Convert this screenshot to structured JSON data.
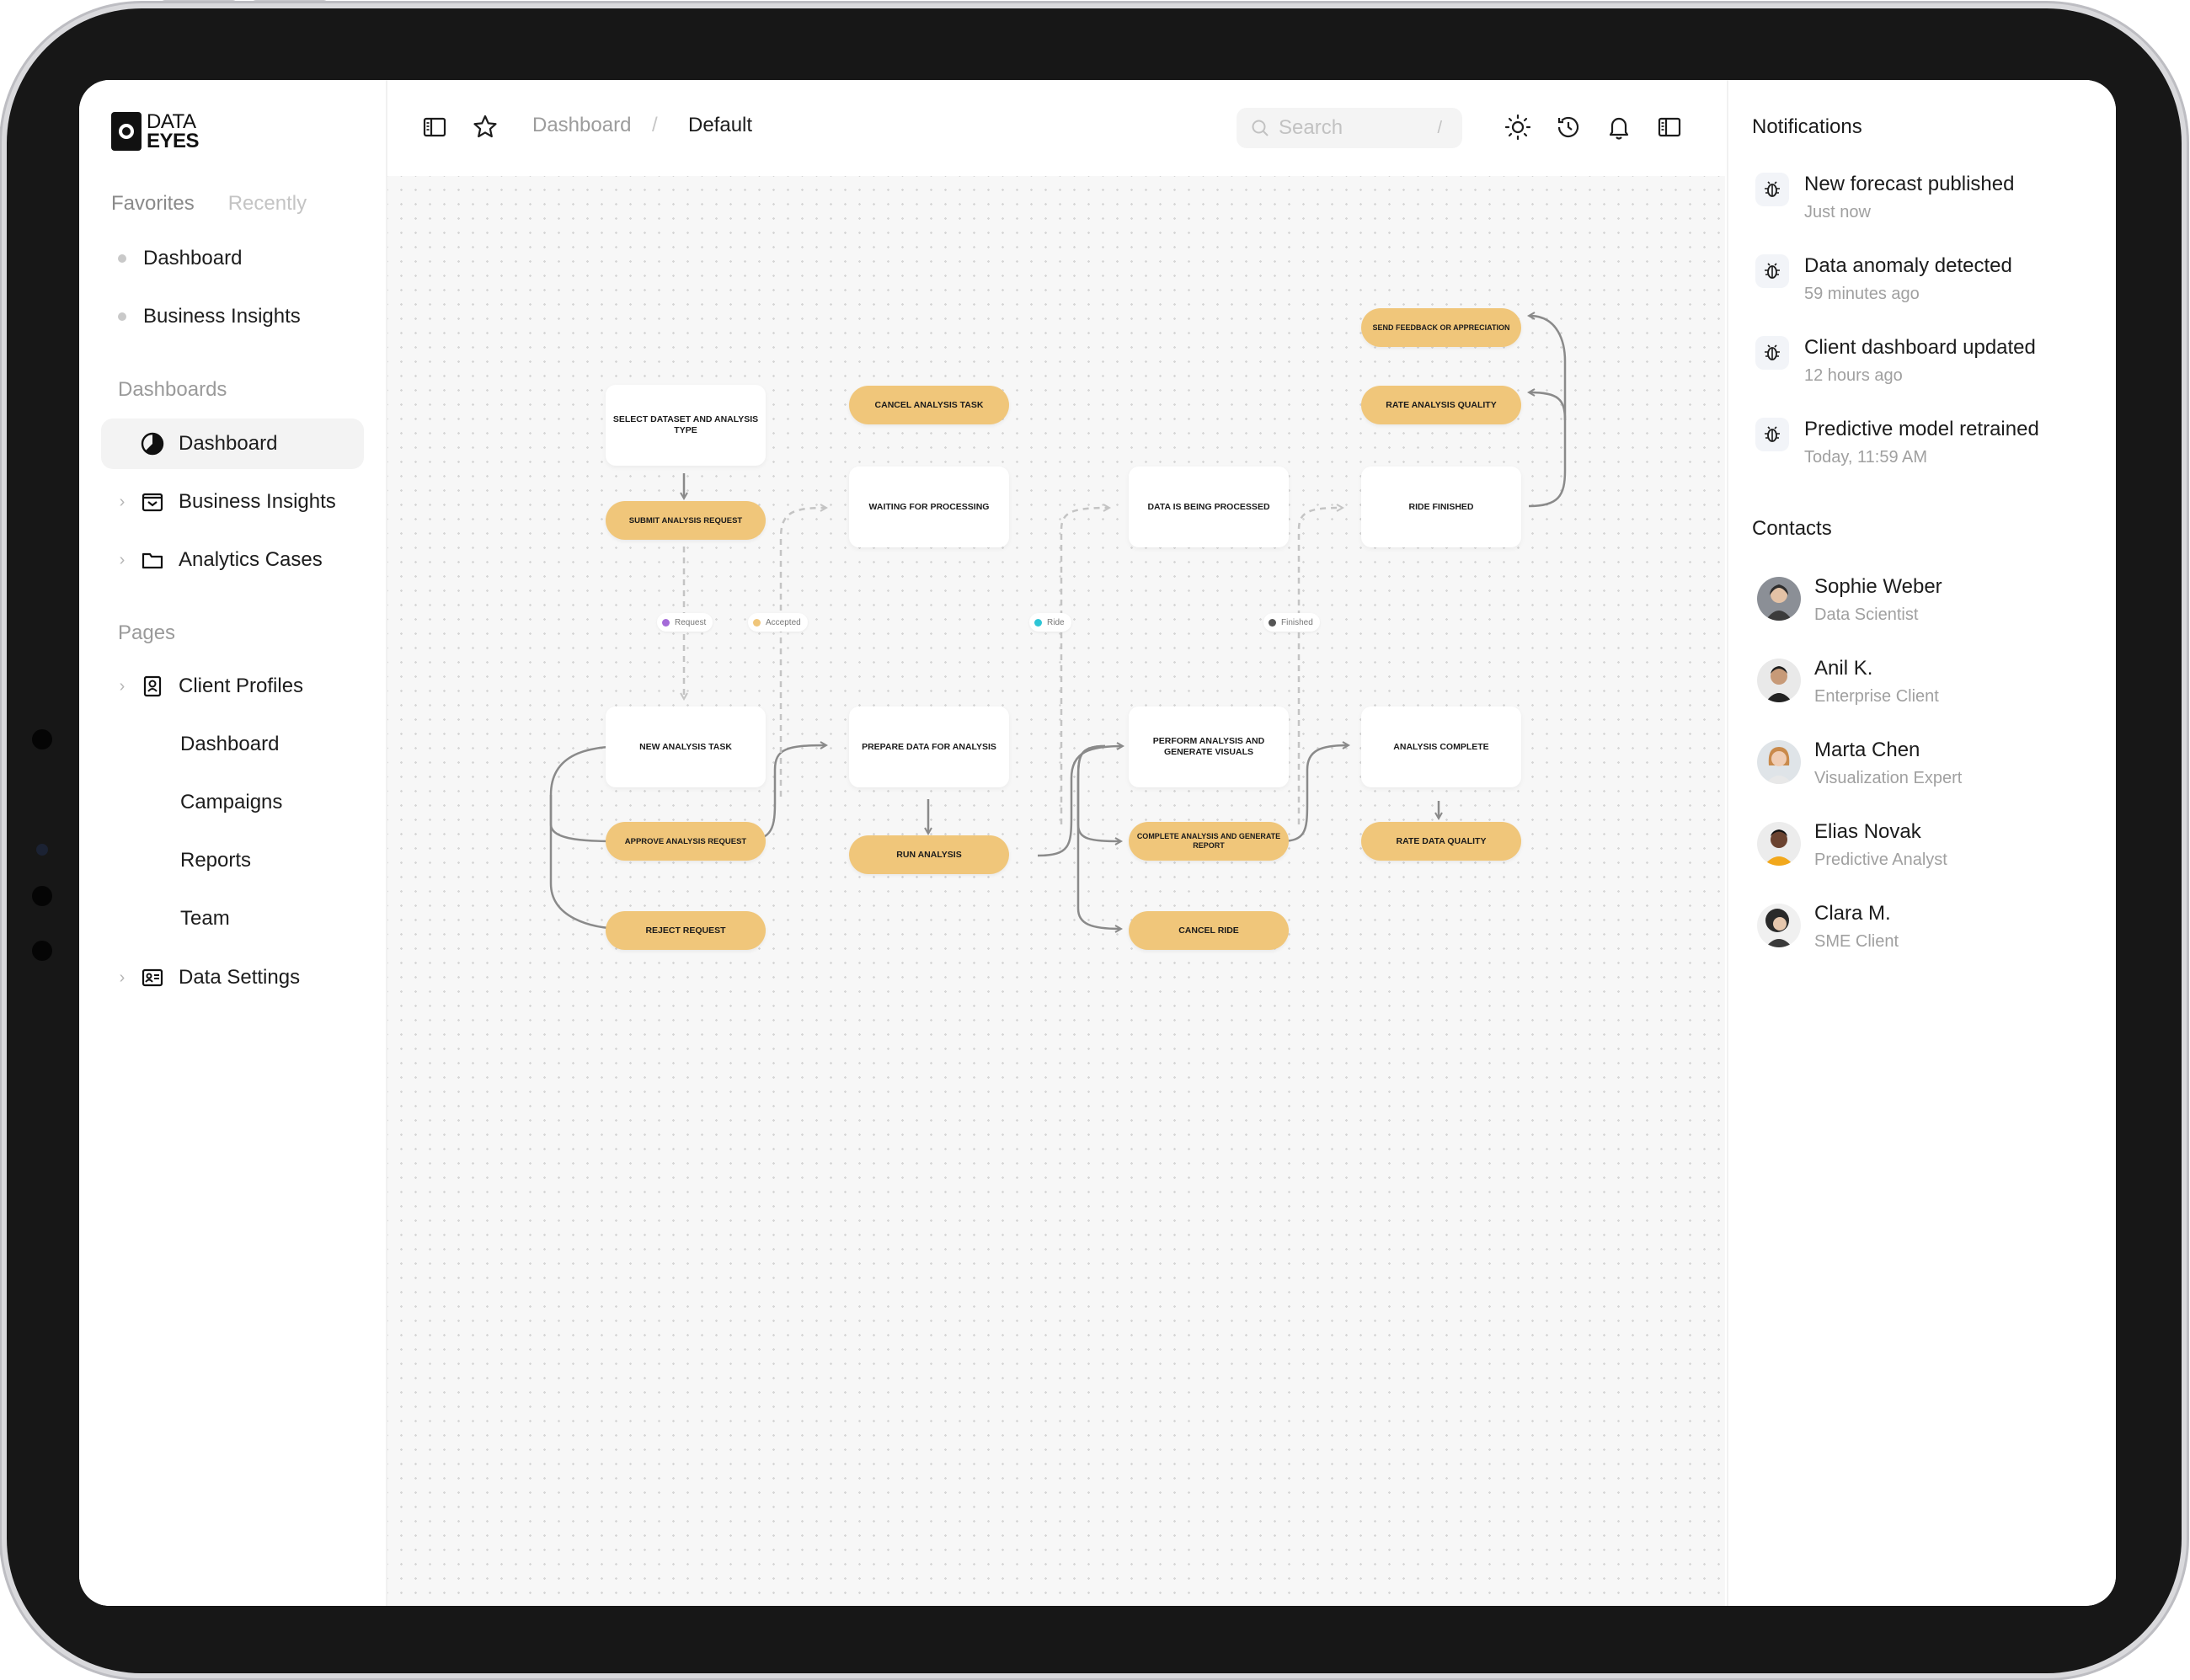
{
  "logo": {
    "line1": "DATA",
    "line2": "EYES"
  },
  "sidebar": {
    "tabs": {
      "favorites": "Favorites",
      "recently": "Recently"
    },
    "favorites": [
      "Dashboard",
      "Business Insights"
    ],
    "dashboards_label": "Dashboards",
    "dashboards": [
      {
        "label": "Dashboard",
        "icon": "pie-chart-icon",
        "active": true
      },
      {
        "label": "Business Insights",
        "icon": "inbox-icon"
      },
      {
        "label": "Analytics Cases",
        "icon": "folder-icon"
      }
    ],
    "pages_label": "Pages",
    "pages": {
      "client_profiles": "Client Profiles",
      "sub": [
        "Dashboard",
        "Campaigns",
        "Reports",
        "Team"
      ],
      "data_settings": "Data Settings"
    }
  },
  "topbar": {
    "breadcrumb_root": "Dashboard",
    "breadcrumb_sep": "/",
    "breadcrumb_current": "Default",
    "search_placeholder": "Search",
    "search_shortcut": "/"
  },
  "flow": {
    "nodes": {
      "select_dataset": "Select dataset and analysis type",
      "submit_request": "Submit analysis request",
      "cancel_task": "Cancel analysis task",
      "waiting": "Waiting for processing",
      "being_processed": "Data is being processed",
      "send_feedback": "Send feedback or appreciation",
      "rate_quality": "Rate analysis quality",
      "ride_finished": "Ride finished",
      "new_task": "New analysis task",
      "approve_request": "Approve analysis request",
      "reject_request": "Reject request",
      "prepare_data": "Prepare data for analysis",
      "run_analysis": "Run analysis",
      "perform_analysis": "Perform analysis and generate visuals",
      "complete_analysis": "Complete analysis and generate report",
      "cancel_ride": "Cancel ride",
      "analysis_complete": "Analysis complete",
      "rate_data_quality": "Rate data quality"
    },
    "tags": {
      "request": "Request",
      "accepted": "Accepted",
      "ride": "Ride",
      "finished": "Finished"
    },
    "tag_colors": {
      "request": "#a46ad8",
      "accepted": "#f0c67a",
      "ride": "#2ec5d6",
      "finished": "#555555"
    }
  },
  "notifications": {
    "title": "Notifications",
    "items": [
      {
        "title": "New forecast published",
        "time": "Just now"
      },
      {
        "title": "Data anomaly detected",
        "time": "59 minutes ago"
      },
      {
        "title": "Client dashboard updated",
        "time": "12 hours ago"
      },
      {
        "title": "Predictive model retrained",
        "time": "Today, 11:59 AM"
      }
    ]
  },
  "contacts": {
    "title": "Contacts",
    "items": [
      {
        "name": "Sophie Weber",
        "role": "Data Scientist"
      },
      {
        "name": "Anil K.",
        "role": "Enterprise Client"
      },
      {
        "name": "Marta Chen",
        "role": "Visualization Expert"
      },
      {
        "name": "Elias Novak",
        "role": "Predictive Analyst"
      },
      {
        "name": "Clara M.",
        "role": "SME Client"
      }
    ]
  },
  "colors": {
    "accent_node": "#f0c67a",
    "canvas_bg": "#f7f7f7"
  }
}
